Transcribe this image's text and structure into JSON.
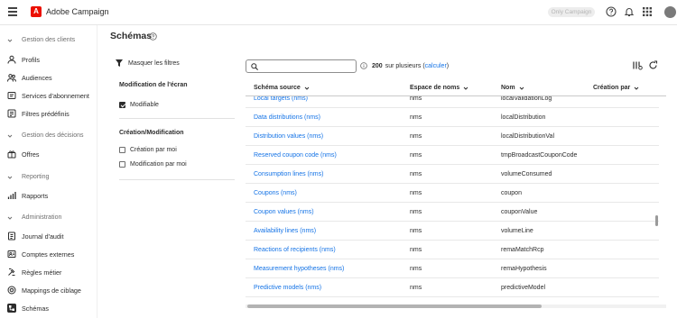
{
  "app": {
    "name": "Adobe Campaign",
    "logo_letter": "A",
    "org": "Only Campaign"
  },
  "colors": {
    "brand": "#eb1000",
    "link": "#1473e6",
    "text": "#2c2c2c"
  },
  "header_icons": [
    "help-icon",
    "bell-icon",
    "app-grid-icon",
    "avatar"
  ],
  "sidebar": {
    "sections": [
      {
        "label": "Gestion des clients",
        "items": [
          "Profils",
          "Audiences",
          "Services d'abonnement",
          "Filtres prédéfinis"
        ]
      },
      {
        "label": "Gestion des décisions",
        "items": [
          "Offres"
        ]
      },
      {
        "label": "Reporting",
        "items": [
          "Rapports"
        ]
      },
      {
        "label": "Administration",
        "items": [
          "Journal d'audit",
          "Comptes externes",
          "Règles métier",
          "Mappings de ciblage",
          "Schémas"
        ]
      }
    ],
    "active": "Schémas"
  },
  "page": {
    "title": "Schémas"
  },
  "filters": {
    "toggle_label": "Masquer les filtres",
    "groups": [
      {
        "title": "Modification de l'écran",
        "options": [
          {
            "label": "Modifiable",
            "checked": true
          }
        ]
      },
      {
        "title": "Création/Modification",
        "options": [
          {
            "label": "Création par moi",
            "checked": false
          },
          {
            "label": "Modification par moi",
            "checked": false
          }
        ]
      }
    ]
  },
  "search": {
    "value": "",
    "placeholder": ""
  },
  "count": {
    "number": "200",
    "text": "sur plusieurs (",
    "link": "calculer",
    "close": ")"
  },
  "table": {
    "columns": [
      "Schéma source",
      "Espace de noms",
      "Nom",
      "Création par"
    ],
    "rows": [
      [
        "Local targets (nms)",
        "nms",
        "localValidationLog"
      ],
      [
        "Data distributions (nms)",
        "nms",
        "localDistribution"
      ],
      [
        "Distribution values (nms)",
        "nms",
        "localDistributionVal"
      ],
      [
        "Reserved coupon code (nms)",
        "nms",
        "tmpBroadcastCouponCode"
      ],
      [
        "Consumption lines (nms)",
        "nms",
        "volumeConsumed"
      ],
      [
        "Coupons (nms)",
        "nms",
        "coupon"
      ],
      [
        "Coupon values (nms)",
        "nms",
        "couponValue"
      ],
      [
        "Availability lines (nms)",
        "nms",
        "volumeLine"
      ],
      [
        "Reactions of recipients (nms)",
        "nms",
        "remaMatchRcp"
      ],
      [
        "Measurement hypotheses (nms)",
        "nms",
        "remaHypothesis"
      ],
      [
        "Predictive models (nms)",
        "nms",
        "predictiveModel"
      ],
      [
        "",
        "",
        ""
      ]
    ]
  }
}
